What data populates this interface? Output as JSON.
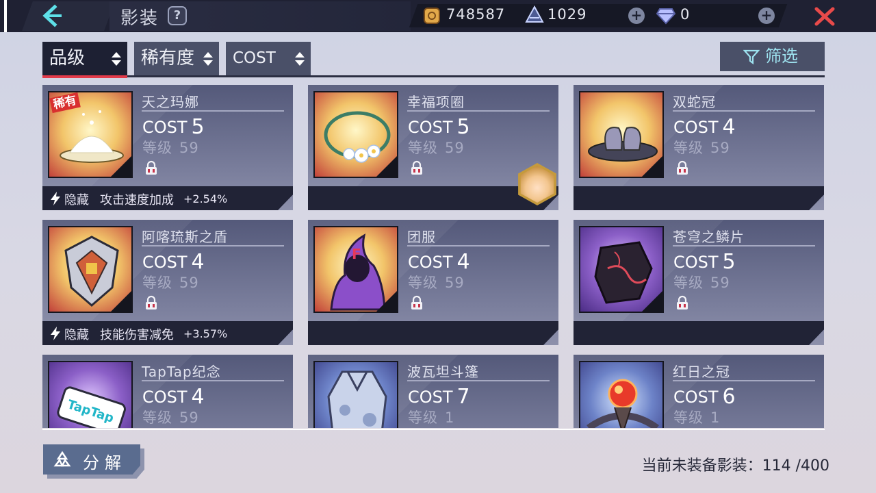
{
  "header": {
    "title": "影装",
    "help_label": "?",
    "gold_amount": "748587",
    "stamina_amount": "1029",
    "gem_amount": "0"
  },
  "sort_tabs": [
    {
      "label": "品级",
      "active": true
    },
    {
      "label": "稀有度",
      "active": false
    },
    {
      "label": "COST",
      "active": false
    }
  ],
  "filter_label": "筛选",
  "cost_label": "COST",
  "level_label": "等级",
  "hidden_label": "隐藏",
  "rare_tag": "稀有",
  "items": [
    {
      "name": "天之玛娜",
      "cost": "5",
      "level": "59",
      "effect": "攻击速度加成",
      "effect_value": "+2.54%",
      "icon": "sugar-bowl-icon"
    },
    {
      "name": "幸福项圈",
      "cost": "5",
      "level": "59",
      "icon": "flower-wreath-icon"
    },
    {
      "name": "双蛇冠",
      "cost": "4",
      "level": "59",
      "icon": "serpent-crown-icon"
    },
    {
      "name": "阿喀琉斯之盾",
      "cost": "4",
      "level": "59",
      "effect": "技能伤害减免",
      "effect_value": "+3.57%",
      "icon": "shield-icon"
    },
    {
      "name": "团服",
      "cost": "4",
      "level": "59",
      "icon": "hood-icon"
    },
    {
      "name": "苍穹之鳞片",
      "cost": "5",
      "level": "59",
      "icon": "scale-icon"
    },
    {
      "name": "TapTap纪念",
      "cost": "4",
      "level": "59",
      "icon": "taptap-card-icon"
    },
    {
      "name": "波瓦坦斗篷",
      "cost": "7",
      "level": "1",
      "icon": "cloak-icon"
    },
    {
      "name": "红日之冠",
      "cost": "6",
      "level": "1",
      "icon": "red-sun-crown-icon"
    }
  ],
  "footer": {
    "decompose_label": "分解",
    "unequipped_label": "当前未装备影装：114 /400"
  },
  "colors": {
    "topbar": "#1f2133",
    "active_tab_underline": "#e23a4a",
    "card_footer": "#212336",
    "close_icon": "#e84a4a"
  }
}
